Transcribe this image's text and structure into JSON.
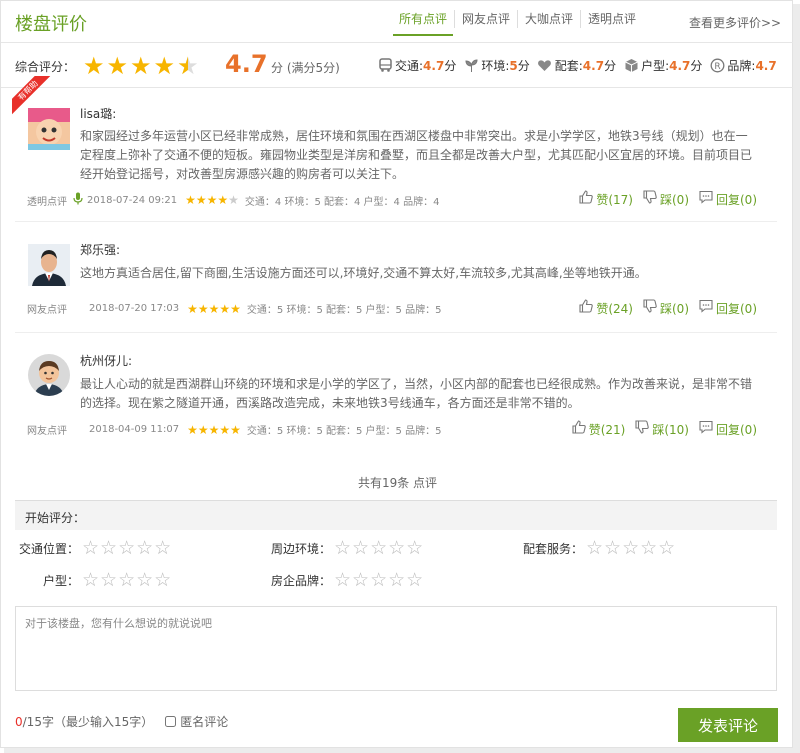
{
  "header": {
    "title": "楼盘评价",
    "tabs": [
      "所有点评",
      "网友点评",
      "大咖点评",
      "透明点评"
    ],
    "more_link": "查看更多评价>>"
  },
  "overall": {
    "label": "综合评分：",
    "score": "4.7",
    "unit": "分 (满分5分)",
    "stars_value": 4.5,
    "subscores": [
      {
        "icon": "bus-icon",
        "label": "交通:",
        "value": "4.7",
        "unit": "分"
      },
      {
        "icon": "sprout-icon",
        "label": "环境:",
        "value": "5",
        "unit": "分"
      },
      {
        "icon": "heart-icon",
        "label": "配套:",
        "value": "4.7",
        "unit": "分"
      },
      {
        "icon": "cube-icon",
        "label": "户型:",
        "value": "4.7",
        "unit": "分"
      },
      {
        "icon": "registered-icon",
        "label": "品牌:",
        "value": "4.7",
        "unit": ""
      }
    ]
  },
  "reviews": [
    {
      "name": "lisa璐:",
      "badge": "有帮助",
      "text": "和家园经过多年运营小区已经非常成熟，居住环境和氛围在西湖区楼盘中非常突出。求是小学学区，地铁3号线（规划）也在一定程度上弥补了交通不便的短板。雍园物业类型是洋房和叠墅，而且全都是改善大户型，尤其匹配小区宜居的环境。目前项目已经开始登记摇号，对改善型房源感兴趣的购房者可以关注下。",
      "source": "透明点评",
      "date": "2018-07-24 09:21",
      "stars": 4,
      "scores": "交通：4 环境：5 配套：4 户型：4 品牌：4",
      "like": "赞(17)",
      "dislike": "踩(0)",
      "reply": "回复(0)"
    },
    {
      "name": "郑乐强:",
      "text": "这地方真适合居住,留下商圈,生活设施方面还可以,环境好,交通不算太好,车流较多,尤其高峰,坐等地铁开通。",
      "source": "网友点评",
      "date": "2018-07-20 17:03",
      "stars": 5,
      "scores": "交通：5 环境：5 配套：5 户型：5 品牌：5",
      "like": "赞(24)",
      "dislike": "踩(0)",
      "reply": "回复(0)"
    },
    {
      "name": "杭州伢儿:",
      "text": "最让人心动的就是西湖群山环绕的环境和求是小学的学区了，当然，小区内部的配套也已经很成熟。作为改善来说，是非常不错的选择。现在紫之隧道开通，西溪路改造完成，未来地铁3号线通车，各方面还是非常不错的。",
      "source": "网友点评",
      "date": "2018-04-09 11:07",
      "stars": 5,
      "scores": "交通：5 环境：5 配套：5 户型：5 品牌：5",
      "like": "赞(21)",
      "dislike": "踩(10)",
      "reply": "回复(0)"
    }
  ],
  "total": "共有19条 点评",
  "form": {
    "title": "开始评分：",
    "fields": [
      "交通位置：",
      "周边环境：",
      "配套服务：",
      "户型：",
      "房企品牌："
    ],
    "placeholder": "对于该楼盘，您有什么想说的就说说吧",
    "count_num": "0",
    "count_rest": "/15字（最少输入15字）",
    "anonymous": "匿名评论",
    "submit": "发表评论"
  },
  "colors": {
    "accent": "#6aa126",
    "score": "#e8712a",
    "star": "#f7b500",
    "count": "#e8302a"
  }
}
